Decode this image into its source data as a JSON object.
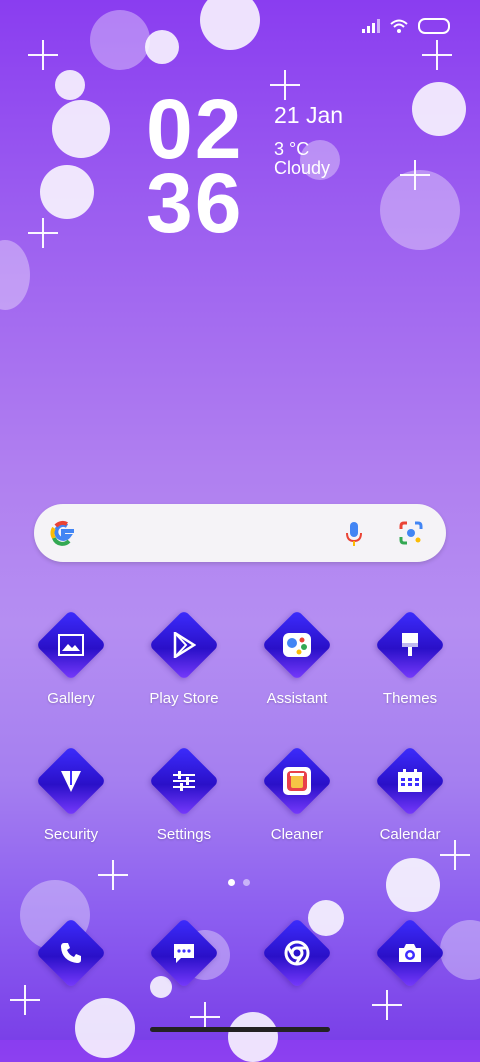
{
  "status": {
    "icons": [
      "signal-icon",
      "wifi-icon",
      "battery-icon"
    ]
  },
  "clock": {
    "hours": "02",
    "minutes": "36"
  },
  "weather": {
    "date": "21 Jan",
    "temp": "3 °C",
    "condition": "Cloudy"
  },
  "search": {
    "logo": "G",
    "icons": [
      "mic-icon",
      "lens-icon"
    ]
  },
  "apps_row1": [
    {
      "label": "Gallery",
      "icon": "gallery-icon"
    },
    {
      "label": "Play Store",
      "icon": "play-store-icon"
    },
    {
      "label": "Assistant",
      "icon": "assistant-icon"
    },
    {
      "label": "Themes",
      "icon": "themes-icon"
    }
  ],
  "apps_row2": [
    {
      "label": "Security",
      "icon": "security-icon"
    },
    {
      "label": "Settings",
      "icon": "settings-icon"
    },
    {
      "label": "Cleaner",
      "icon": "cleaner-icon"
    },
    {
      "label": "Calendar",
      "icon": "calendar-icon"
    }
  ],
  "dock": [
    {
      "icon": "phone-icon"
    },
    {
      "icon": "messages-icon"
    },
    {
      "icon": "chrome-icon"
    },
    {
      "icon": "camera-icon"
    }
  ],
  "pager": {
    "pages": 2,
    "active": 1
  },
  "colors": {
    "accent": "#3d2dff",
    "background_top": "#8a3df0",
    "background_mid": "#b58ef2"
  }
}
